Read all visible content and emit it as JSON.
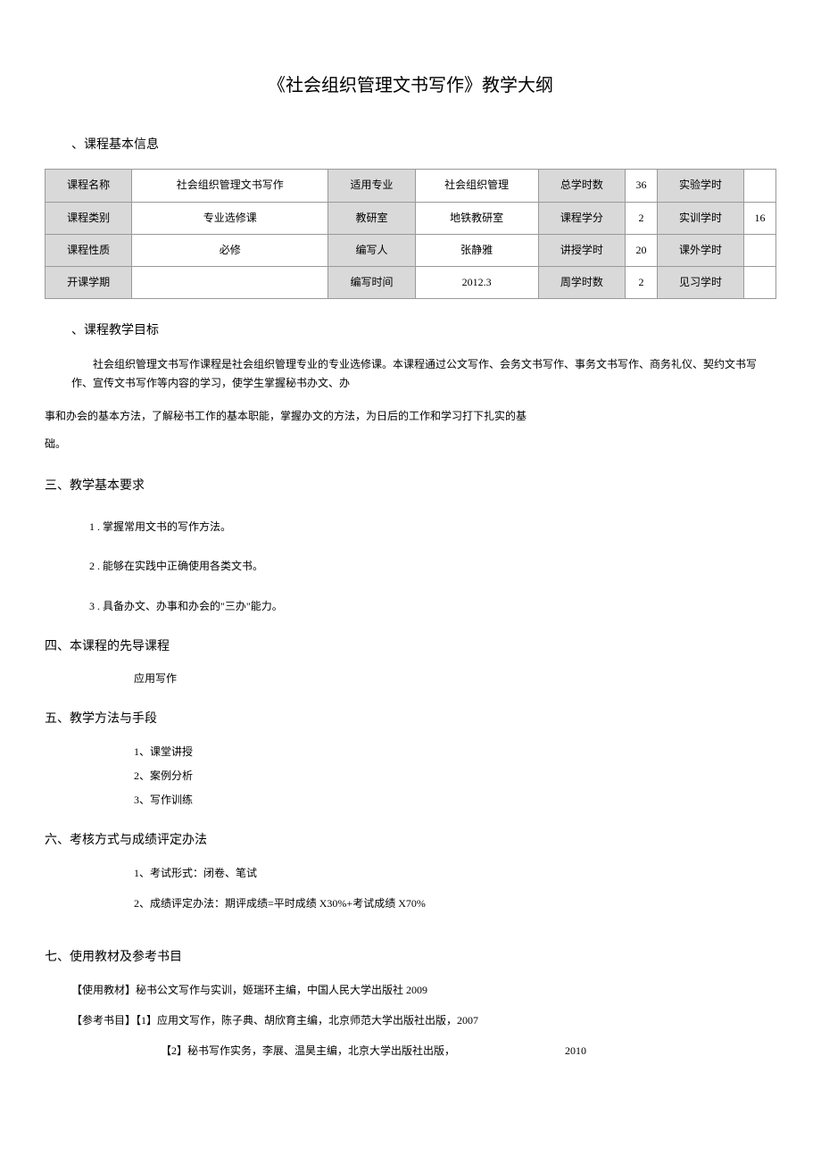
{
  "title": "《社会组织管理文书写作》教学大纲",
  "section1": {
    "heading": "、课程基本信息",
    "table": {
      "r1c1": "课程名称",
      "r1c2": "社会组织管理文书写作",
      "r1c3": "适用专业",
      "r1c4": "社会组织管理",
      "r1c5": "总学时数",
      "r1c6": "36",
      "r1c7": "实验学时",
      "r1c8": "",
      "r2c1": "课程类别",
      "r2c2": "专业选修课",
      "r2c3": "教研室",
      "r2c4": "地铁教研室",
      "r2c5": "课程学分",
      "r2c6": "2",
      "r2c7": "实训学时",
      "r2c8": "16",
      "r3c1": "课程性质",
      "r3c2": "必修",
      "r3c3": "编写人",
      "r3c4": "张静雅",
      "r3c5": "讲授学时",
      "r3c6": "20",
      "r3c7": "课外学时",
      "r3c8": "",
      "r4c1": "开课学期",
      "r4c2": "",
      "r4c3": "编写时间",
      "r4c4": "2012.3",
      "r4c5": "周学时数",
      "r4c6": "2",
      "r4c7": "见习学时",
      "r4c8": ""
    }
  },
  "section2": {
    "heading": "、课程教学目标",
    "para1": "社会组织管理文书写作课程是社会组织管理专业的专业选修课。本课程通过公文写作、会务文书写作、事务文书写作、商务礼仪、契约文书写作、宣传文书写作等内容的学习，使学生掌握秘书办文、办",
    "para2": "事和办会的基本方法，了解秘书工作的基本职能，掌握办文的方法，为日后的工作和学习打下扎实的基",
    "para3": "础。"
  },
  "section3": {
    "heading": "三、教学基本要求",
    "item1": "1 . 掌握常用文书的写作方法。",
    "item2": "2 . 能够在实践中正确使用各类文书。",
    "item3": "3 . 具备办文、办事和办会的\"三办\"能力。"
  },
  "section4": {
    "heading": "四、本课程的先导课程",
    "content": "应用写作"
  },
  "section5": {
    "heading": "五、教学方法与手段",
    "item1": "1、课堂讲授",
    "item2": "2、案例分析",
    "item3": "3、写作训练"
  },
  "section6": {
    "heading": "六、考核方式与成绩评定办法",
    "item1": "1、考试形式：闭卷、笔试",
    "item2": "2、成绩评定办法：期评成绩=平时成绩 X30%+考试成绩 X70%"
  },
  "section7": {
    "heading": "七、使用教材及参考书目",
    "textbook": "【使用教材】秘书公文写作与实训，姬瑞环主编，中国人民大学出版社 2009",
    "ref1": "【参考书目】【1】应用文写作，陈子典、胡欣育主编，北京师范大学出版社出版，2007",
    "ref2": "【2】秘书写作实务，李展、温昊主编，北京大学出版社出版，",
    "ref2year": "2010"
  }
}
